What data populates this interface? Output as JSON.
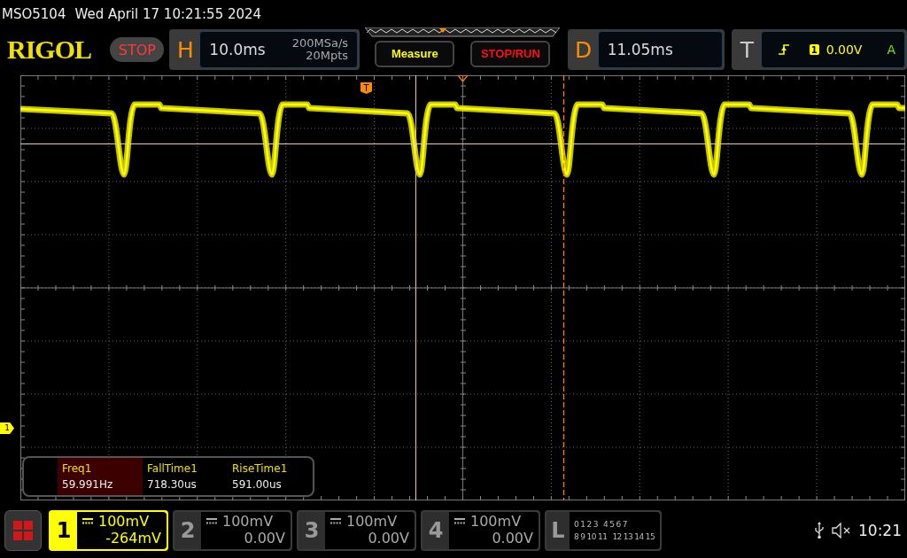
{
  "status_line": {
    "model": "MSO5104",
    "datetime": "Wed April 17 10:21:55 2024"
  },
  "header": {
    "logo": "RIGOL",
    "run_state": "STOP",
    "horizontal": {
      "label": "H",
      "timebase": "10.0ms",
      "sample_rate": "200MSa/s",
      "memory_depth": "20Mpts"
    },
    "buttons": [
      {
        "label": "Measure",
        "kind": "measure"
      },
      {
        "label": "STOP/RUN",
        "kind": "runstop"
      }
    ],
    "delay": {
      "label": "D",
      "value": "11.05ms"
    },
    "trigger": {
      "label": "T",
      "source": "1",
      "level": "0.00V",
      "mode": "A"
    }
  },
  "graticule": {
    "channel_marker": "1",
    "trigger_marker": "T"
  },
  "measurements": [
    {
      "name": "Freq1",
      "value": "59.991Hz",
      "selected": true
    },
    {
      "name": "FallTime1",
      "value": "718.30us",
      "selected": false
    },
    {
      "name": "RiseTime1",
      "value": "591.00us",
      "selected": false
    }
  ],
  "channels": [
    {
      "number": "1",
      "scale": "100mV",
      "offset": "-264mV",
      "active": true
    },
    {
      "number": "2",
      "scale": "100mV",
      "offset": "0.00V",
      "active": false
    },
    {
      "number": "3",
      "scale": "100mV",
      "offset": "0.00V",
      "active": false
    },
    {
      "number": "4",
      "scale": "100mV",
      "offset": "0.00V",
      "active": false
    }
  ],
  "logic": {
    "label": "L",
    "bit_rows": [
      [
        "0",
        "1",
        "2",
        "3",
        "4",
        "5",
        "6",
        "7"
      ],
      [
        "8",
        "9",
        "10",
        "11",
        "12",
        "13",
        "14",
        "15"
      ]
    ]
  },
  "tray": {
    "time": "10:21"
  }
}
